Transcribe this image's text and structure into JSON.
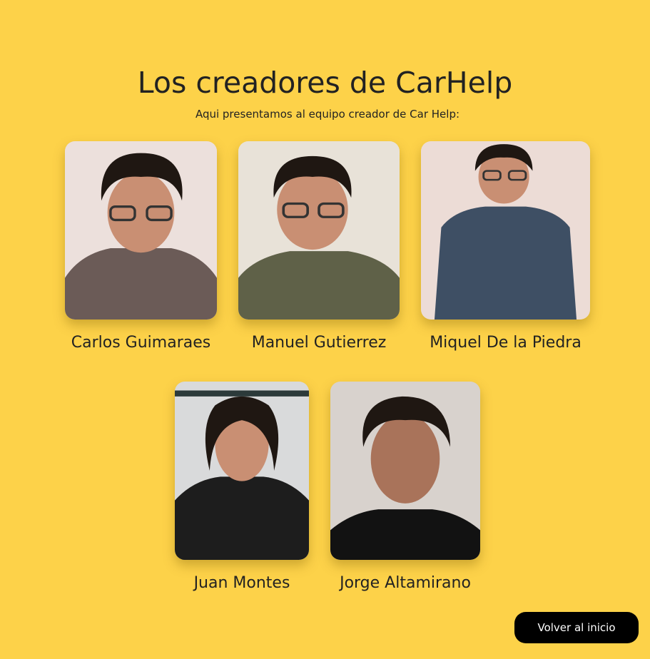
{
  "header": {
    "title": "Los creadores de CarHelp",
    "subtitle": "Aqui presentamos al equipo creador de Car Help:"
  },
  "team": [
    {
      "name": "Carlos Guimaraes",
      "photo_bg": "#ece0dc",
      "shirt": "#6b5b57"
    },
    {
      "name": "Manuel Gutierrez",
      "photo_bg": "#e8e2d8",
      "shirt": "#5f6148"
    },
    {
      "name": "Miquel De la Piedra",
      "photo_bg": "#ecdcd6",
      "shirt": "#3e4f64"
    },
    {
      "name": "Juan Montes",
      "photo_bg": "#d9dadb",
      "shirt": "#1d1d1d"
    },
    {
      "name": "Jorge Altamirano",
      "photo_bg": "#d8d2cd",
      "shirt": "#121212"
    }
  ],
  "footer": {
    "back_label": "Volver al inicio"
  },
  "colors": {
    "background": "#fdd249",
    "text": "#222222",
    "button_bg": "#000000",
    "button_text": "#ffffff",
    "skin": "#c98f73",
    "hair": "#1f1712"
  }
}
